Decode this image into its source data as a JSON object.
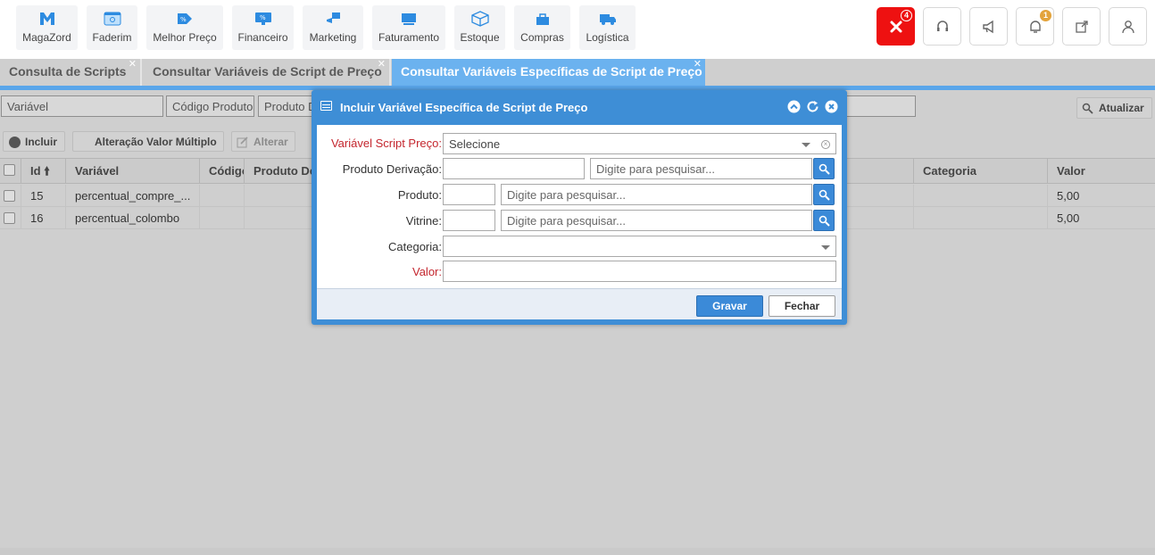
{
  "nav": {
    "items": [
      {
        "label": "MagaZord",
        "icon": "magazord-logo-icon"
      },
      {
        "label": "Faderim",
        "icon": "faderim-icon"
      },
      {
        "label": "Melhor Preço",
        "icon": "best-price-icon"
      },
      {
        "label": "Financeiro",
        "icon": "finance-icon"
      },
      {
        "label": "Marketing",
        "icon": "marketing-icon"
      },
      {
        "label": "Faturamento",
        "icon": "billing-icon"
      },
      {
        "label": "Estoque",
        "icon": "stock-box-icon"
      },
      {
        "label": "Compras",
        "icon": "shopping-bag-icon"
      },
      {
        "label": "Logística",
        "icon": "truck-icon"
      }
    ],
    "close_badge": "4",
    "notification_badge": "1"
  },
  "tabs": [
    {
      "label": "Consulta de Scripts"
    },
    {
      "label": "Consultar Variáveis de Script de Preço"
    },
    {
      "label": "Consultar Variáveis Específicas de Script de Preço"
    }
  ],
  "filters": {
    "variavel": "Variável",
    "codigo_produto": "Código Produto",
    "produto": "Produto Derivação"
  },
  "toolbar": {
    "incluir": "Incluir",
    "alteracao": "Alteração Valor Múltiplo",
    "alterar": "Alterar",
    "atualizar": "Atualizar"
  },
  "grid": {
    "columns": {
      "id": "Id",
      "variavel": "Variável",
      "codigo": "Código",
      "produto": "Produto Derivação",
      "categoria": "Categoria",
      "valor": "Valor"
    },
    "rows": [
      {
        "id": "15",
        "variavel": "percentual_compre_...",
        "valor": "5,00"
      },
      {
        "id": "16",
        "variavel": "percentual_colombo",
        "valor": "5,00"
      }
    ]
  },
  "modal": {
    "title": "Incluir Variável Específica de Script de Preço",
    "fields": {
      "variavel_label": "Variável Script Preço:",
      "variavel_value": "Selecione",
      "derivacao_label": "Produto Derivação:",
      "derivacao_placeholder": "Digite para pesquisar...",
      "produto_label": "Produto:",
      "produto_placeholder": "Digite para pesquisar...",
      "vitrine_label": "Vitrine:",
      "vitrine_placeholder": "Digite para pesquisar...",
      "categoria_label": "Categoria:",
      "valor_label": "Valor:"
    },
    "buttons": {
      "gravar": "Gravar",
      "fechar": "Fechar"
    }
  },
  "colors": {
    "accent": "#3b8ad8",
    "active_tab": "#6bb2ef",
    "danger": "#ee1111",
    "required_label": "#c4262e"
  }
}
